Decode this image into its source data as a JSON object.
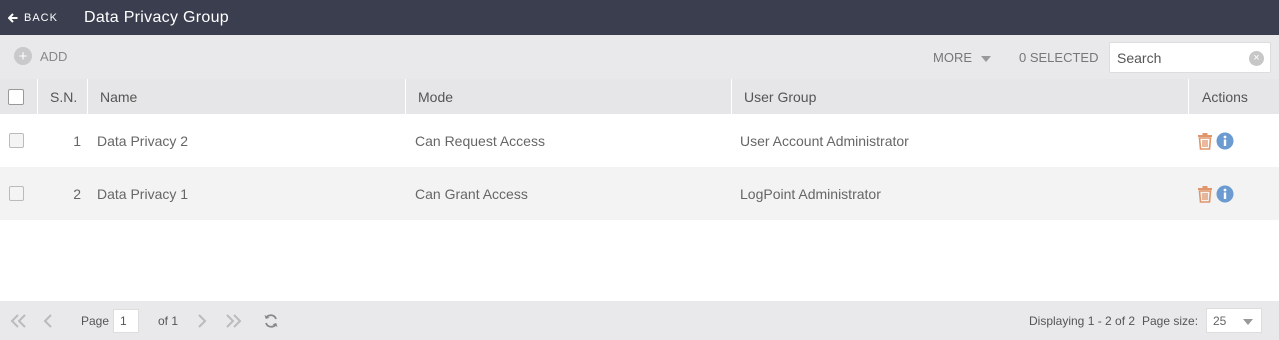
{
  "header": {
    "back_label": "BACK",
    "title": "Data Privacy Group"
  },
  "toolbar": {
    "add_label": "ADD",
    "more_label": "MORE",
    "selected_label": "0 SELECTED",
    "search_placeholder": "Search"
  },
  "table": {
    "columns": {
      "sn": "S.N.",
      "name": "Name",
      "mode": "Mode",
      "user_group": "User Group",
      "actions": "Actions"
    },
    "rows": [
      {
        "sn": "1",
        "name": "Data Privacy 2",
        "mode": "Can Request Access",
        "user_group": "User Account Administrator"
      },
      {
        "sn": "2",
        "name": "Data Privacy 1",
        "mode": "Can Grant Access",
        "user_group": "LogPoint Administrator"
      }
    ]
  },
  "pagination": {
    "page_label": "Page",
    "page_value": "1",
    "of_label": "of 1",
    "displaying": "Displaying 1 - 2 of 2",
    "page_size_label": "Page size:",
    "page_size_value": "25"
  },
  "colors": {
    "titlebar": "#3b3e4e",
    "delete_icon": "#e0956a",
    "info_icon": "#6b9bd1"
  }
}
